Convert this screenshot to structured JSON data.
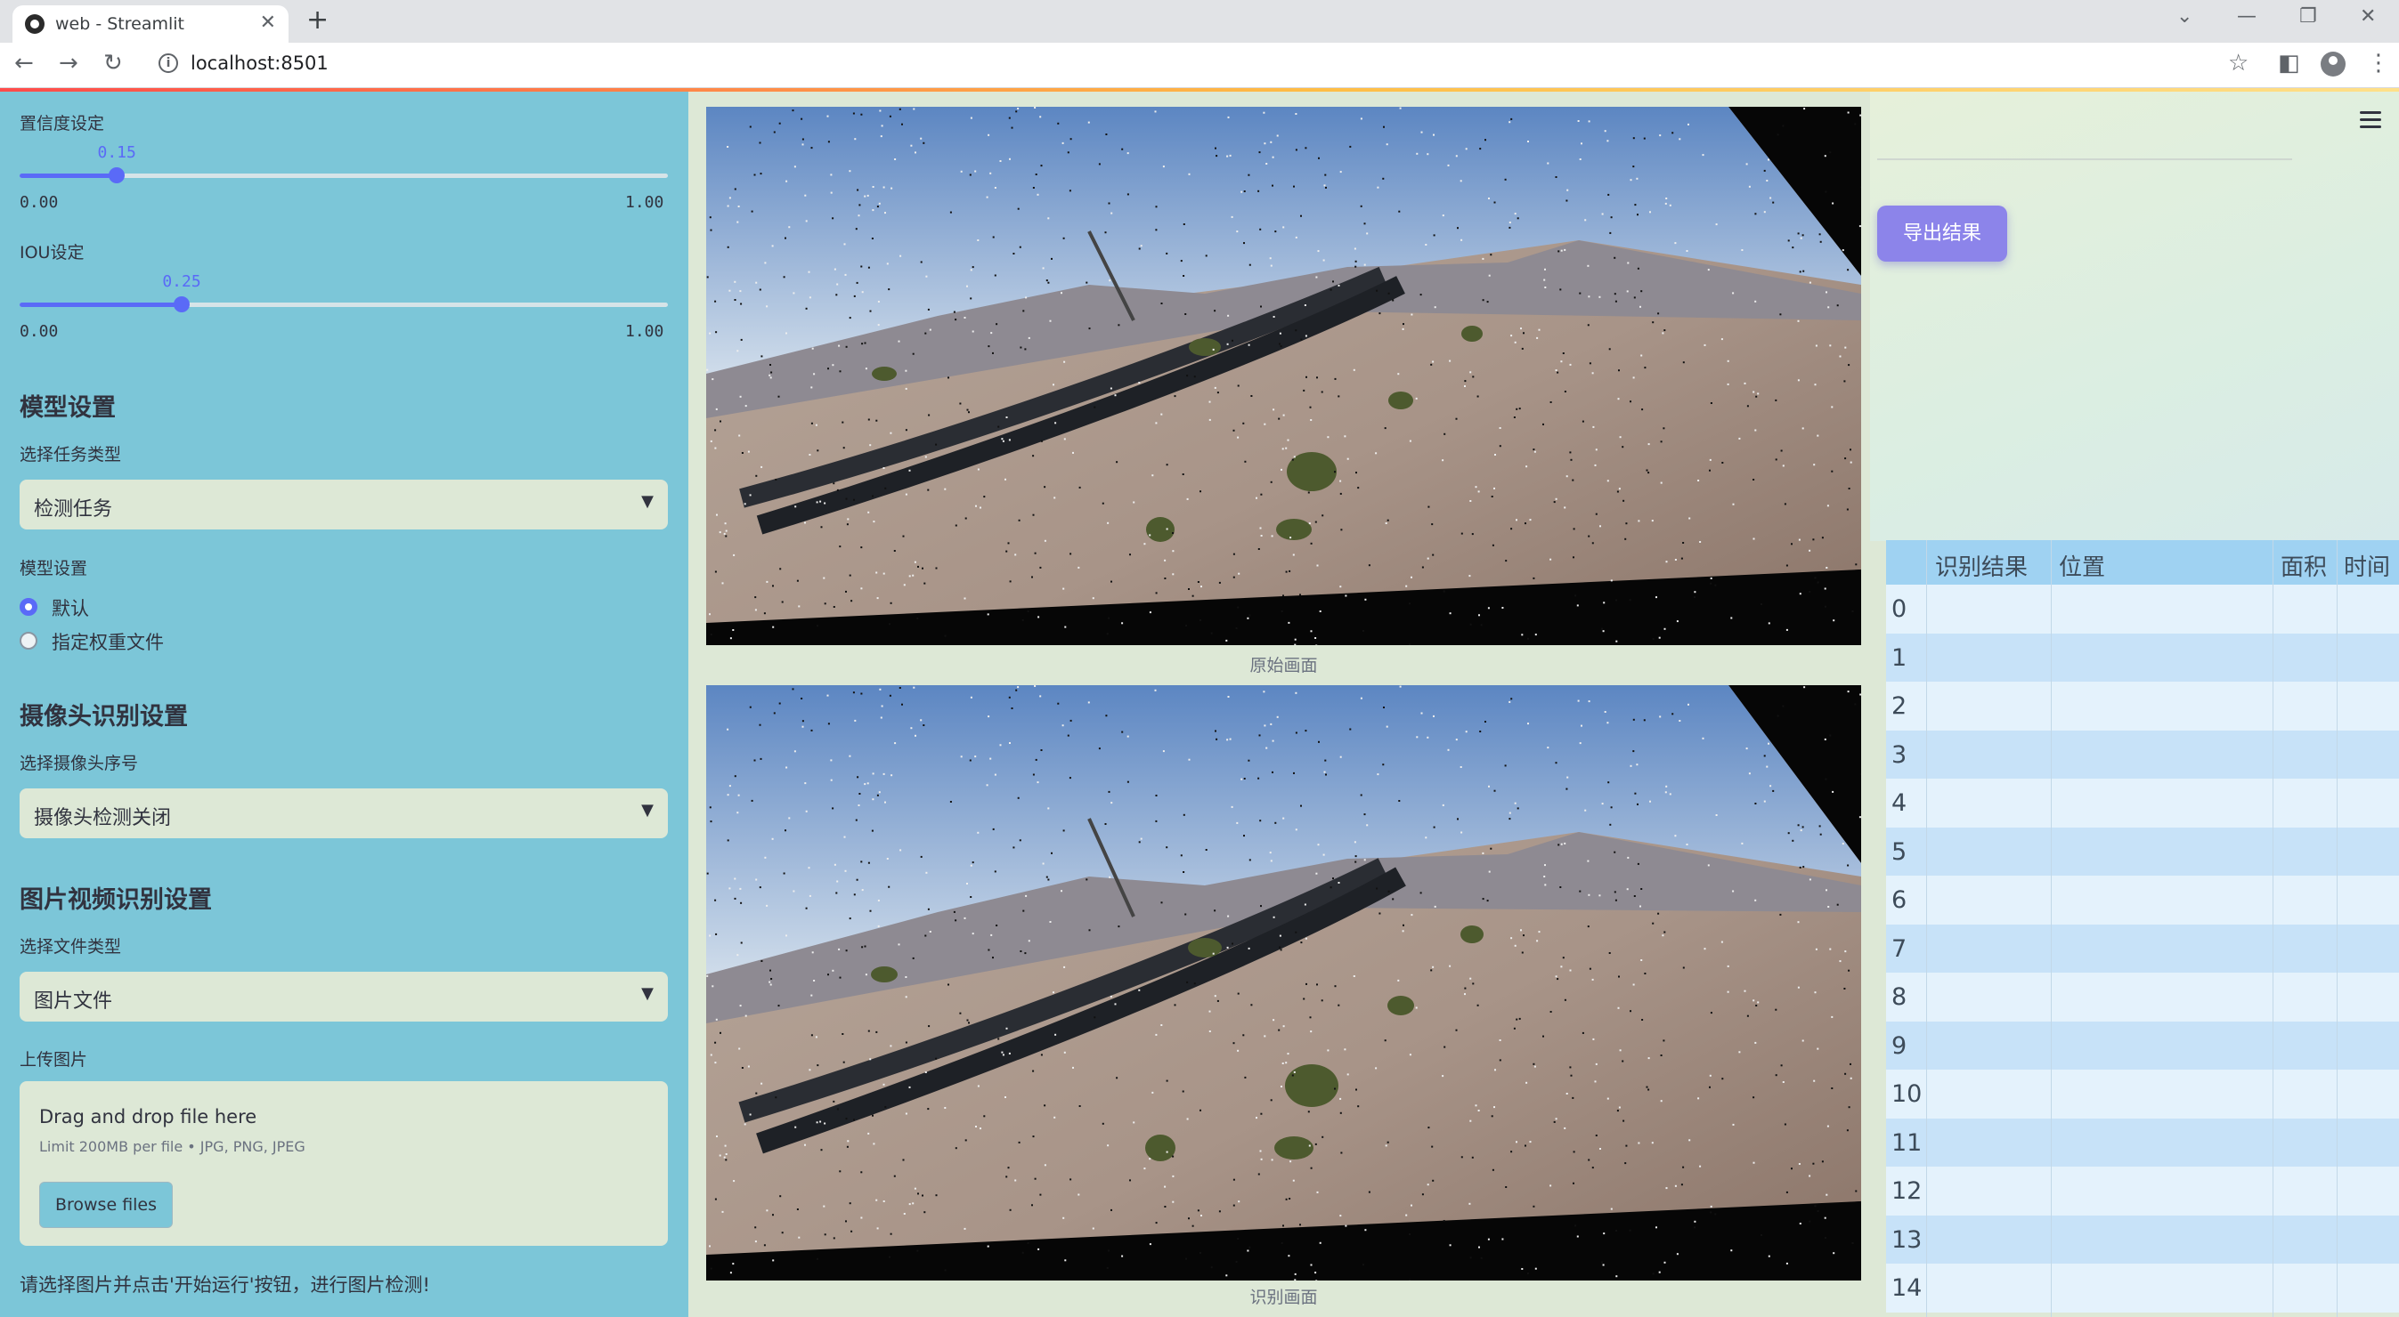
{
  "browser": {
    "tab_title": "web - Streamlit",
    "url": "localhost:8501"
  },
  "sidebar": {
    "confidence": {
      "label": "置信度设定",
      "value": "0.15",
      "min": "0.00",
      "max": "1.00",
      "fraction": 0.15
    },
    "iou": {
      "label": "IOU设定",
      "value": "0.25",
      "min": "0.00",
      "max": "1.00",
      "fraction": 0.25
    },
    "model_section": {
      "heading": "模型设置",
      "task_label": "选择任务类型",
      "task_value": "检测任务",
      "weights_label": "模型设置",
      "options": [
        "默认",
        "指定权重文件"
      ],
      "selected": 0
    },
    "camera_section": {
      "heading": "摄像头识别设置",
      "camera_label": "选择摄像头序号",
      "camera_value": "摄像头检测关闭"
    },
    "media_section": {
      "heading": "图片视频识别设置",
      "file_type_label": "选择文件类型",
      "file_type_value": "图片文件",
      "upload_label": "上传图片",
      "drop_text": "Drag and drop file here",
      "limit_text": "Limit 200MB per file • JPG, PNG, JPEG",
      "browse_label": "Browse files"
    },
    "hint": "请选择图片并点击'开始运行'按钮，进行图片检测!"
  },
  "main": {
    "original_caption": "原始画面",
    "result_caption": "识别画面"
  },
  "right": {
    "export_label": "导出结果",
    "table": {
      "columns": [
        "识别结果",
        "位置",
        "面积",
        "时间"
      ],
      "rows": [
        "0",
        "1",
        "2",
        "3",
        "4",
        "5",
        "6",
        "7",
        "8",
        "9",
        "10",
        "11",
        "12",
        "13",
        "14"
      ]
    }
  },
  "colors": {
    "sidebar_bg": "#7cc6d8",
    "accent": "#5a6af7",
    "export_button": "#8c84ea",
    "table_header": "#9fd2f2"
  }
}
